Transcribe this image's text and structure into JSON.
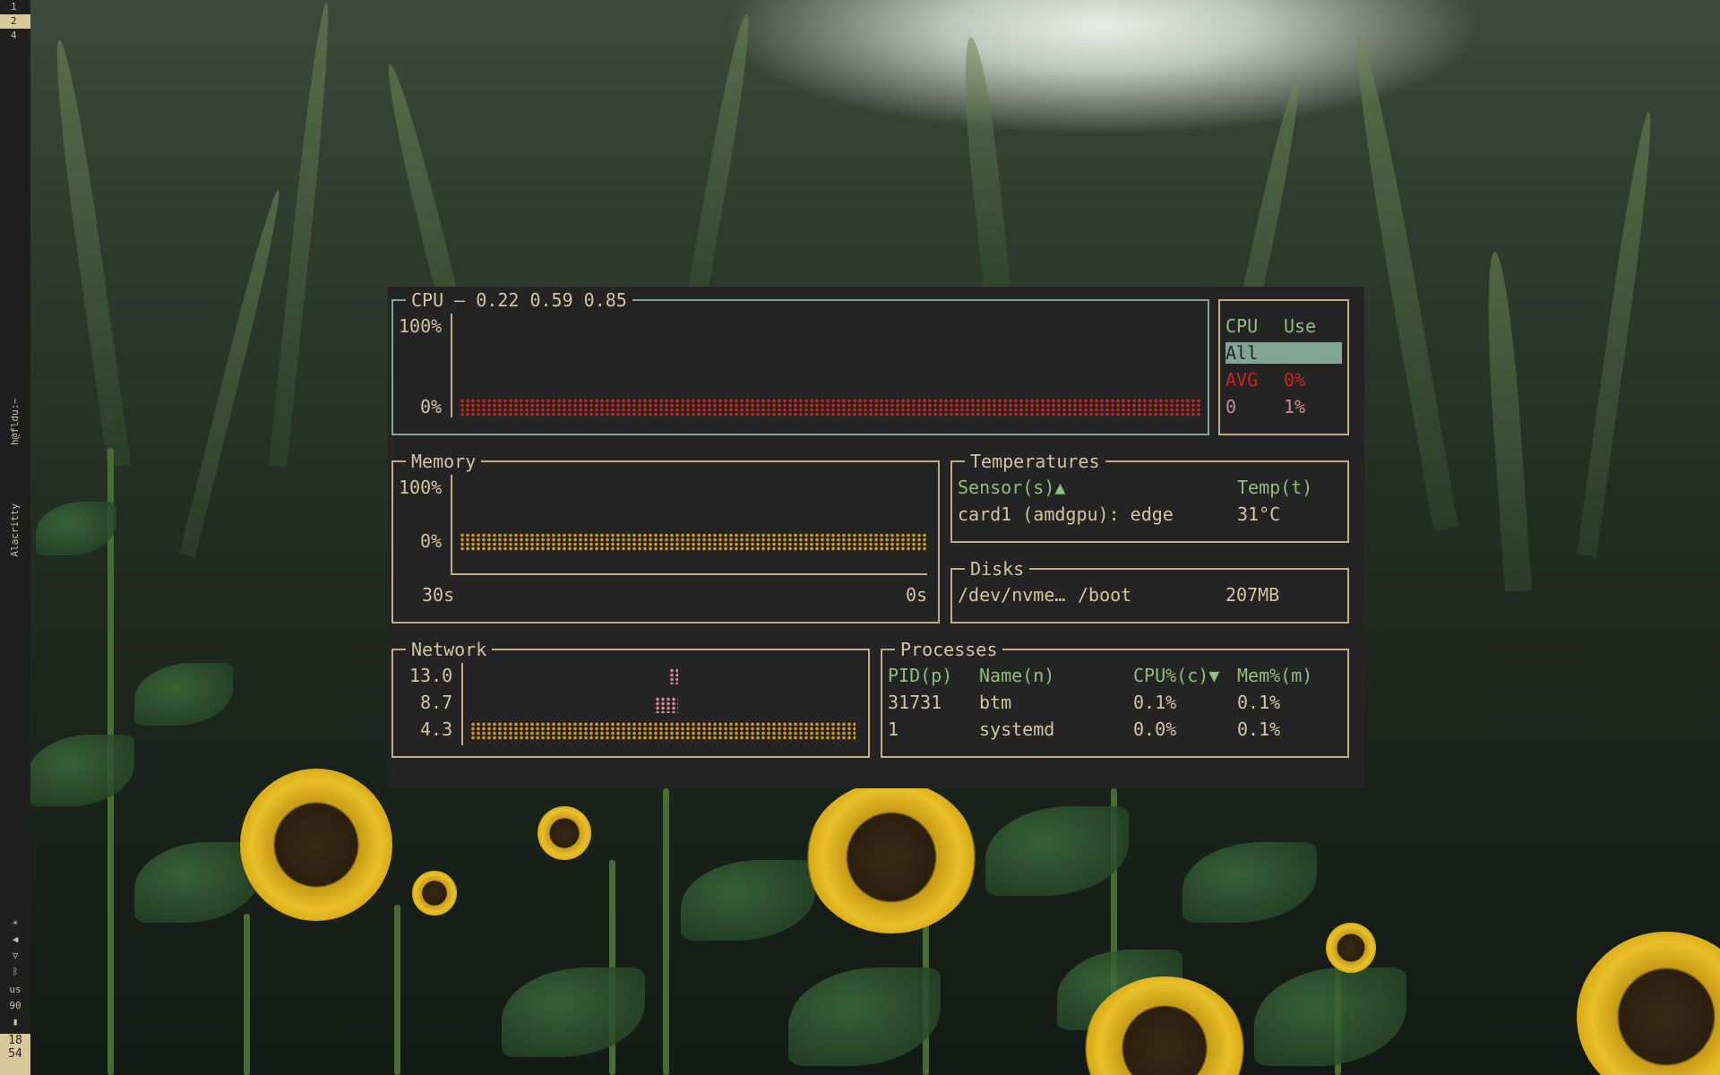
{
  "sidebar": {
    "workspaces": [
      "1",
      "2",
      "4"
    ],
    "window_title": "h@fldu:~",
    "app_name": "Alacritty",
    "keyboard_layout": "us",
    "volume": "90",
    "clock_hour": "18",
    "clock_minute": "54"
  },
  "cpu": {
    "title": "CPU — 0.22 0.59 0.85",
    "y_max": "100%",
    "y_min": "0%",
    "table_headers": [
      "CPU",
      "Use"
    ],
    "rows": [
      {
        "cpu": "All",
        "use": ""
      },
      {
        "cpu": "AVG",
        "use": "0%"
      },
      {
        "cpu": "0",
        "use": "1%"
      }
    ]
  },
  "memory": {
    "title": "Memory",
    "y_max": "100%",
    "y_min": "0%",
    "x_start": "30s",
    "x_end": "0s"
  },
  "temperatures": {
    "title": "Temperatures",
    "headers": [
      "Sensor(s)▲",
      "Temp(t)"
    ],
    "rows": [
      {
        "sensor": "card1 (amdgpu): edge",
        "temp": "31°C"
      }
    ]
  },
  "disks": {
    "title": "Disks",
    "rows": [
      {
        "device": "/dev/nvme…",
        "mount": "/boot",
        "size": "207MB"
      }
    ]
  },
  "network": {
    "title": "Network",
    "y_labels": [
      "13.0",
      "8.7",
      "4.3"
    ]
  },
  "processes": {
    "title": "Processes",
    "headers": [
      "PID(p)",
      "Name(n)",
      "CPU%(c)▼",
      "Mem%(m)"
    ],
    "rows": [
      {
        "pid": "31731",
        "name": "btm",
        "cpu": "0.1%",
        "mem": "0.1%"
      },
      {
        "pid": "1",
        "name": "systemd",
        "cpu": "0.0%",
        "mem": "0.1%"
      }
    ]
  },
  "colors": {
    "accent": "#83a598",
    "border": "#c2ad86",
    "header": "#8ec07c",
    "cpu_graph": "#cc241d",
    "mem_graph": "#d79921",
    "net_rx": "#d79921",
    "net_tx": "#d3869b"
  }
}
